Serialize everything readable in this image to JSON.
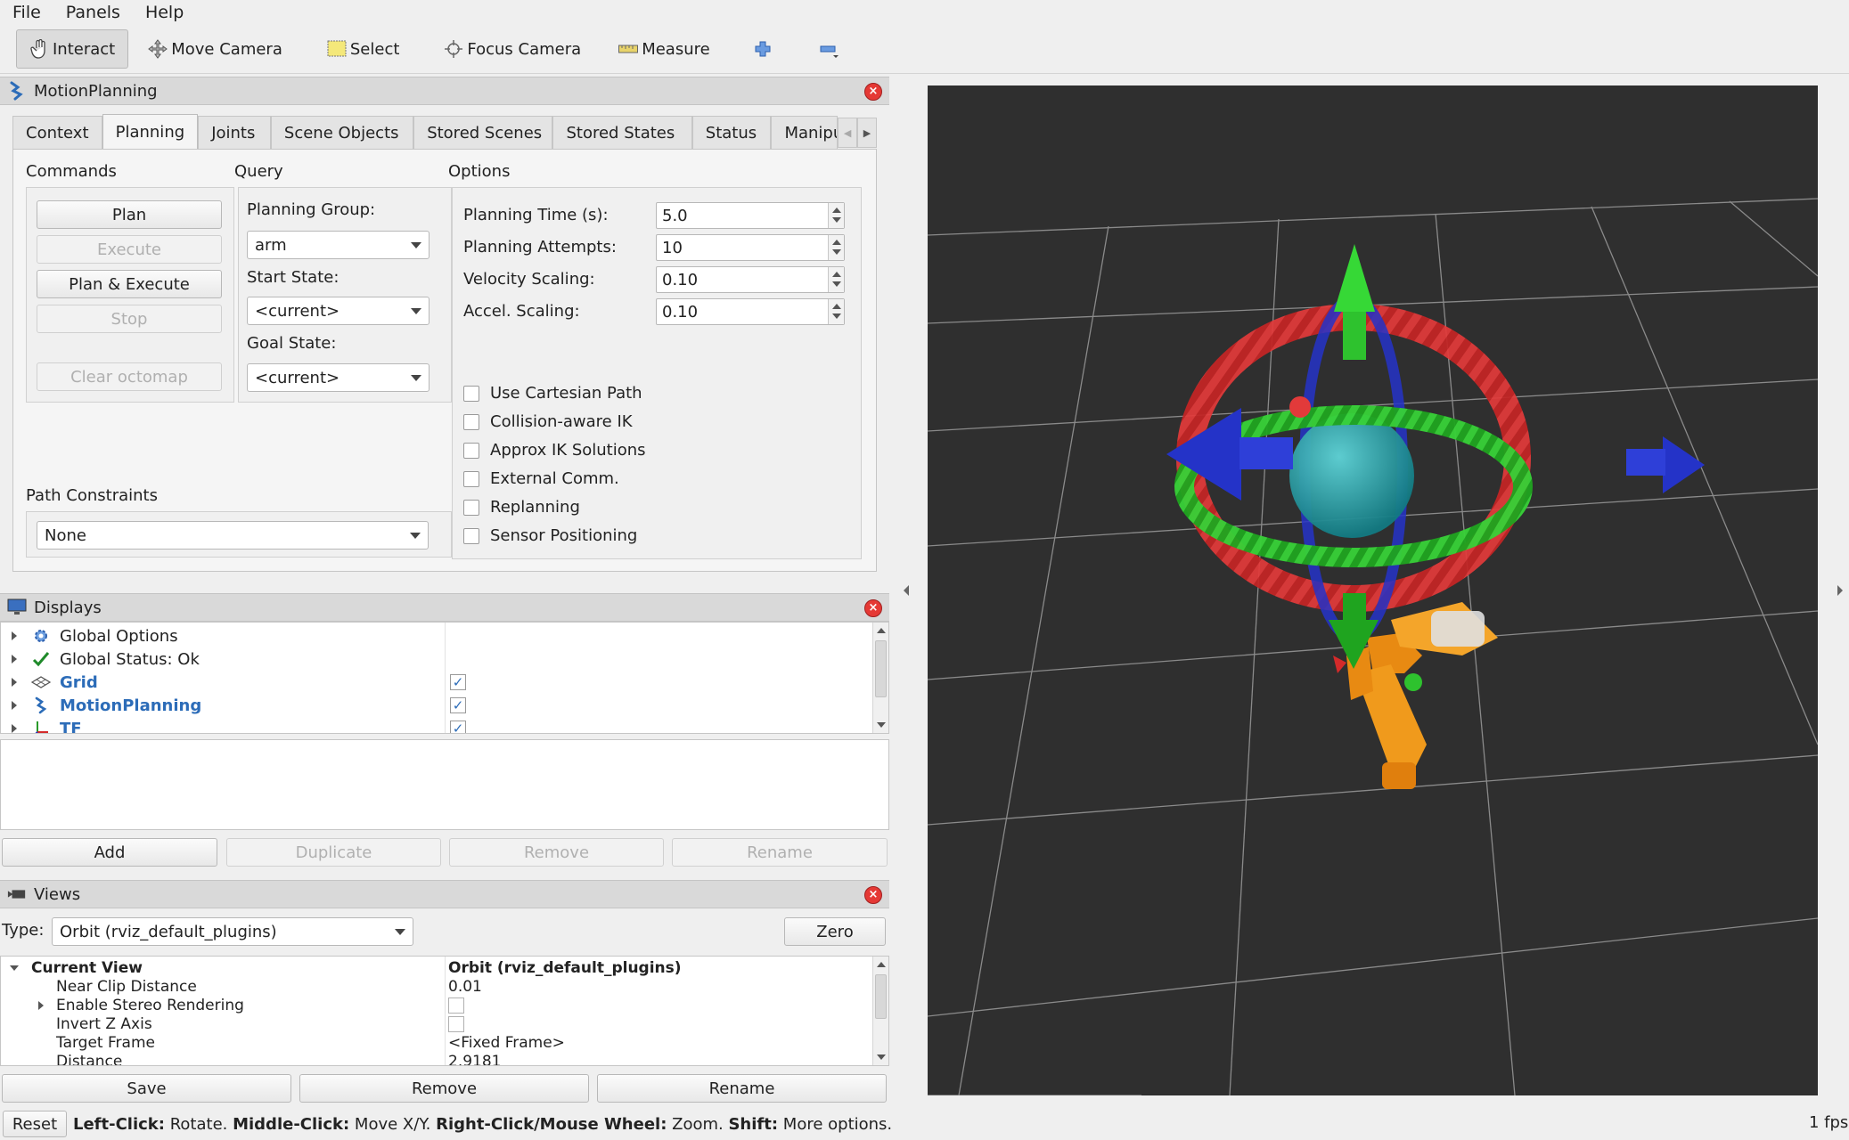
{
  "menu": {
    "items": [
      "File",
      "Panels",
      "Help"
    ]
  },
  "toolbar": {
    "tools": [
      {
        "label": "Interact",
        "icon": "hand-cursor-icon",
        "active": true
      },
      {
        "label": "Move Camera",
        "icon": "move-camera-icon"
      },
      {
        "label": "Select",
        "icon": "select-icon"
      },
      {
        "label": "Focus Camera",
        "icon": "focus-camera-icon"
      },
      {
        "label": "Measure",
        "icon": "ruler-icon"
      }
    ]
  },
  "motion_panel": {
    "title": "MotionPlanning",
    "tabs": [
      "Context",
      "Planning",
      "Joints",
      "Scene Objects",
      "Stored Scenes",
      "Stored States",
      "Status",
      "Manipu"
    ],
    "active_tab": "Planning",
    "commands": {
      "label": "Commands",
      "plan": "Plan",
      "execute": "Execute",
      "plan_execute": "Plan & Execute",
      "stop": "Stop",
      "clear_octomap": "Clear octomap"
    },
    "query": {
      "label": "Query",
      "planning_group_label": "Planning Group:",
      "planning_group_value": "arm",
      "start_state_label": "Start State:",
      "start_state_value": "<current>",
      "goal_state_label": "Goal State:",
      "goal_state_value": "<current>"
    },
    "options": {
      "label": "Options",
      "planning_time_label": "Planning Time (s):",
      "planning_time_value": "5.0",
      "planning_attempts_label": "Planning Attempts:",
      "planning_attempts_value": "10",
      "velocity_scaling_label": "Velocity Scaling:",
      "velocity_scaling_value": "0.10",
      "accel_scaling_label": "Accel. Scaling:",
      "accel_scaling_value": "0.10",
      "checkboxes": [
        "Use Cartesian Path",
        "Collision-aware IK",
        "Approx IK Solutions",
        "External Comm.",
        "Replanning",
        "Sensor Positioning"
      ]
    },
    "path_constraints": {
      "label": "Path Constraints",
      "value": "None"
    }
  },
  "displays_panel": {
    "title": "Displays",
    "items": [
      {
        "label": "Global Options",
        "icon": "gear-icon"
      },
      {
        "label": "Global Status: Ok",
        "icon": "checkmark-icon"
      },
      {
        "label": "Grid",
        "icon": "grid-icon",
        "checked": true
      },
      {
        "label": "MotionPlanning",
        "icon": "motion-planning-icon",
        "checked": true
      },
      {
        "label": "TF",
        "icon": "tf-axes-icon",
        "checked": true
      }
    ],
    "buttons": {
      "add": "Add",
      "duplicate": "Duplicate",
      "remove": "Remove",
      "rename": "Rename"
    }
  },
  "views_panel": {
    "title": "Views",
    "type_label": "Type:",
    "type_value": "Orbit (rviz_default_plugins)",
    "zero": "Zero",
    "rows": [
      {
        "name": "Current View",
        "value": "Orbit (rviz_default_plugins)"
      },
      {
        "name": "Near Clip Distance",
        "value": "0.01"
      },
      {
        "name": "Enable Stereo Rendering",
        "value": ""
      },
      {
        "name": "Invert Z Axis",
        "value": ""
      },
      {
        "name": "Target Frame",
        "value": "<Fixed Frame>"
      },
      {
        "name": "Distance",
        "value": "2.9181"
      }
    ],
    "buttons": {
      "save": "Save",
      "remove": "Remove",
      "rename": "Rename"
    }
  },
  "status_bar": {
    "reset": "Reset",
    "hints": [
      {
        "key": "Left-Click:",
        "text": " Rotate. "
      },
      {
        "key": "Middle-Click:",
        "text": " Move X/Y. "
      },
      {
        "key": "Right-Click/Mouse Wheel:",
        "text": " Zoom. "
      },
      {
        "key": "Shift:",
        "text": " More options."
      }
    ],
    "fps": "1 fps"
  },
  "colors": {
    "viewport_bg": "#2f2f2f",
    "grid_line": "#8c8c8c",
    "ring_red": "#d42a2a",
    "ring_green": "#2ec22e",
    "arrow_blue": "#2433c8",
    "sphere_cyan": "#20a8b0",
    "robot_orange": "#f08c14",
    "link_blue": "#2c6cb8"
  }
}
